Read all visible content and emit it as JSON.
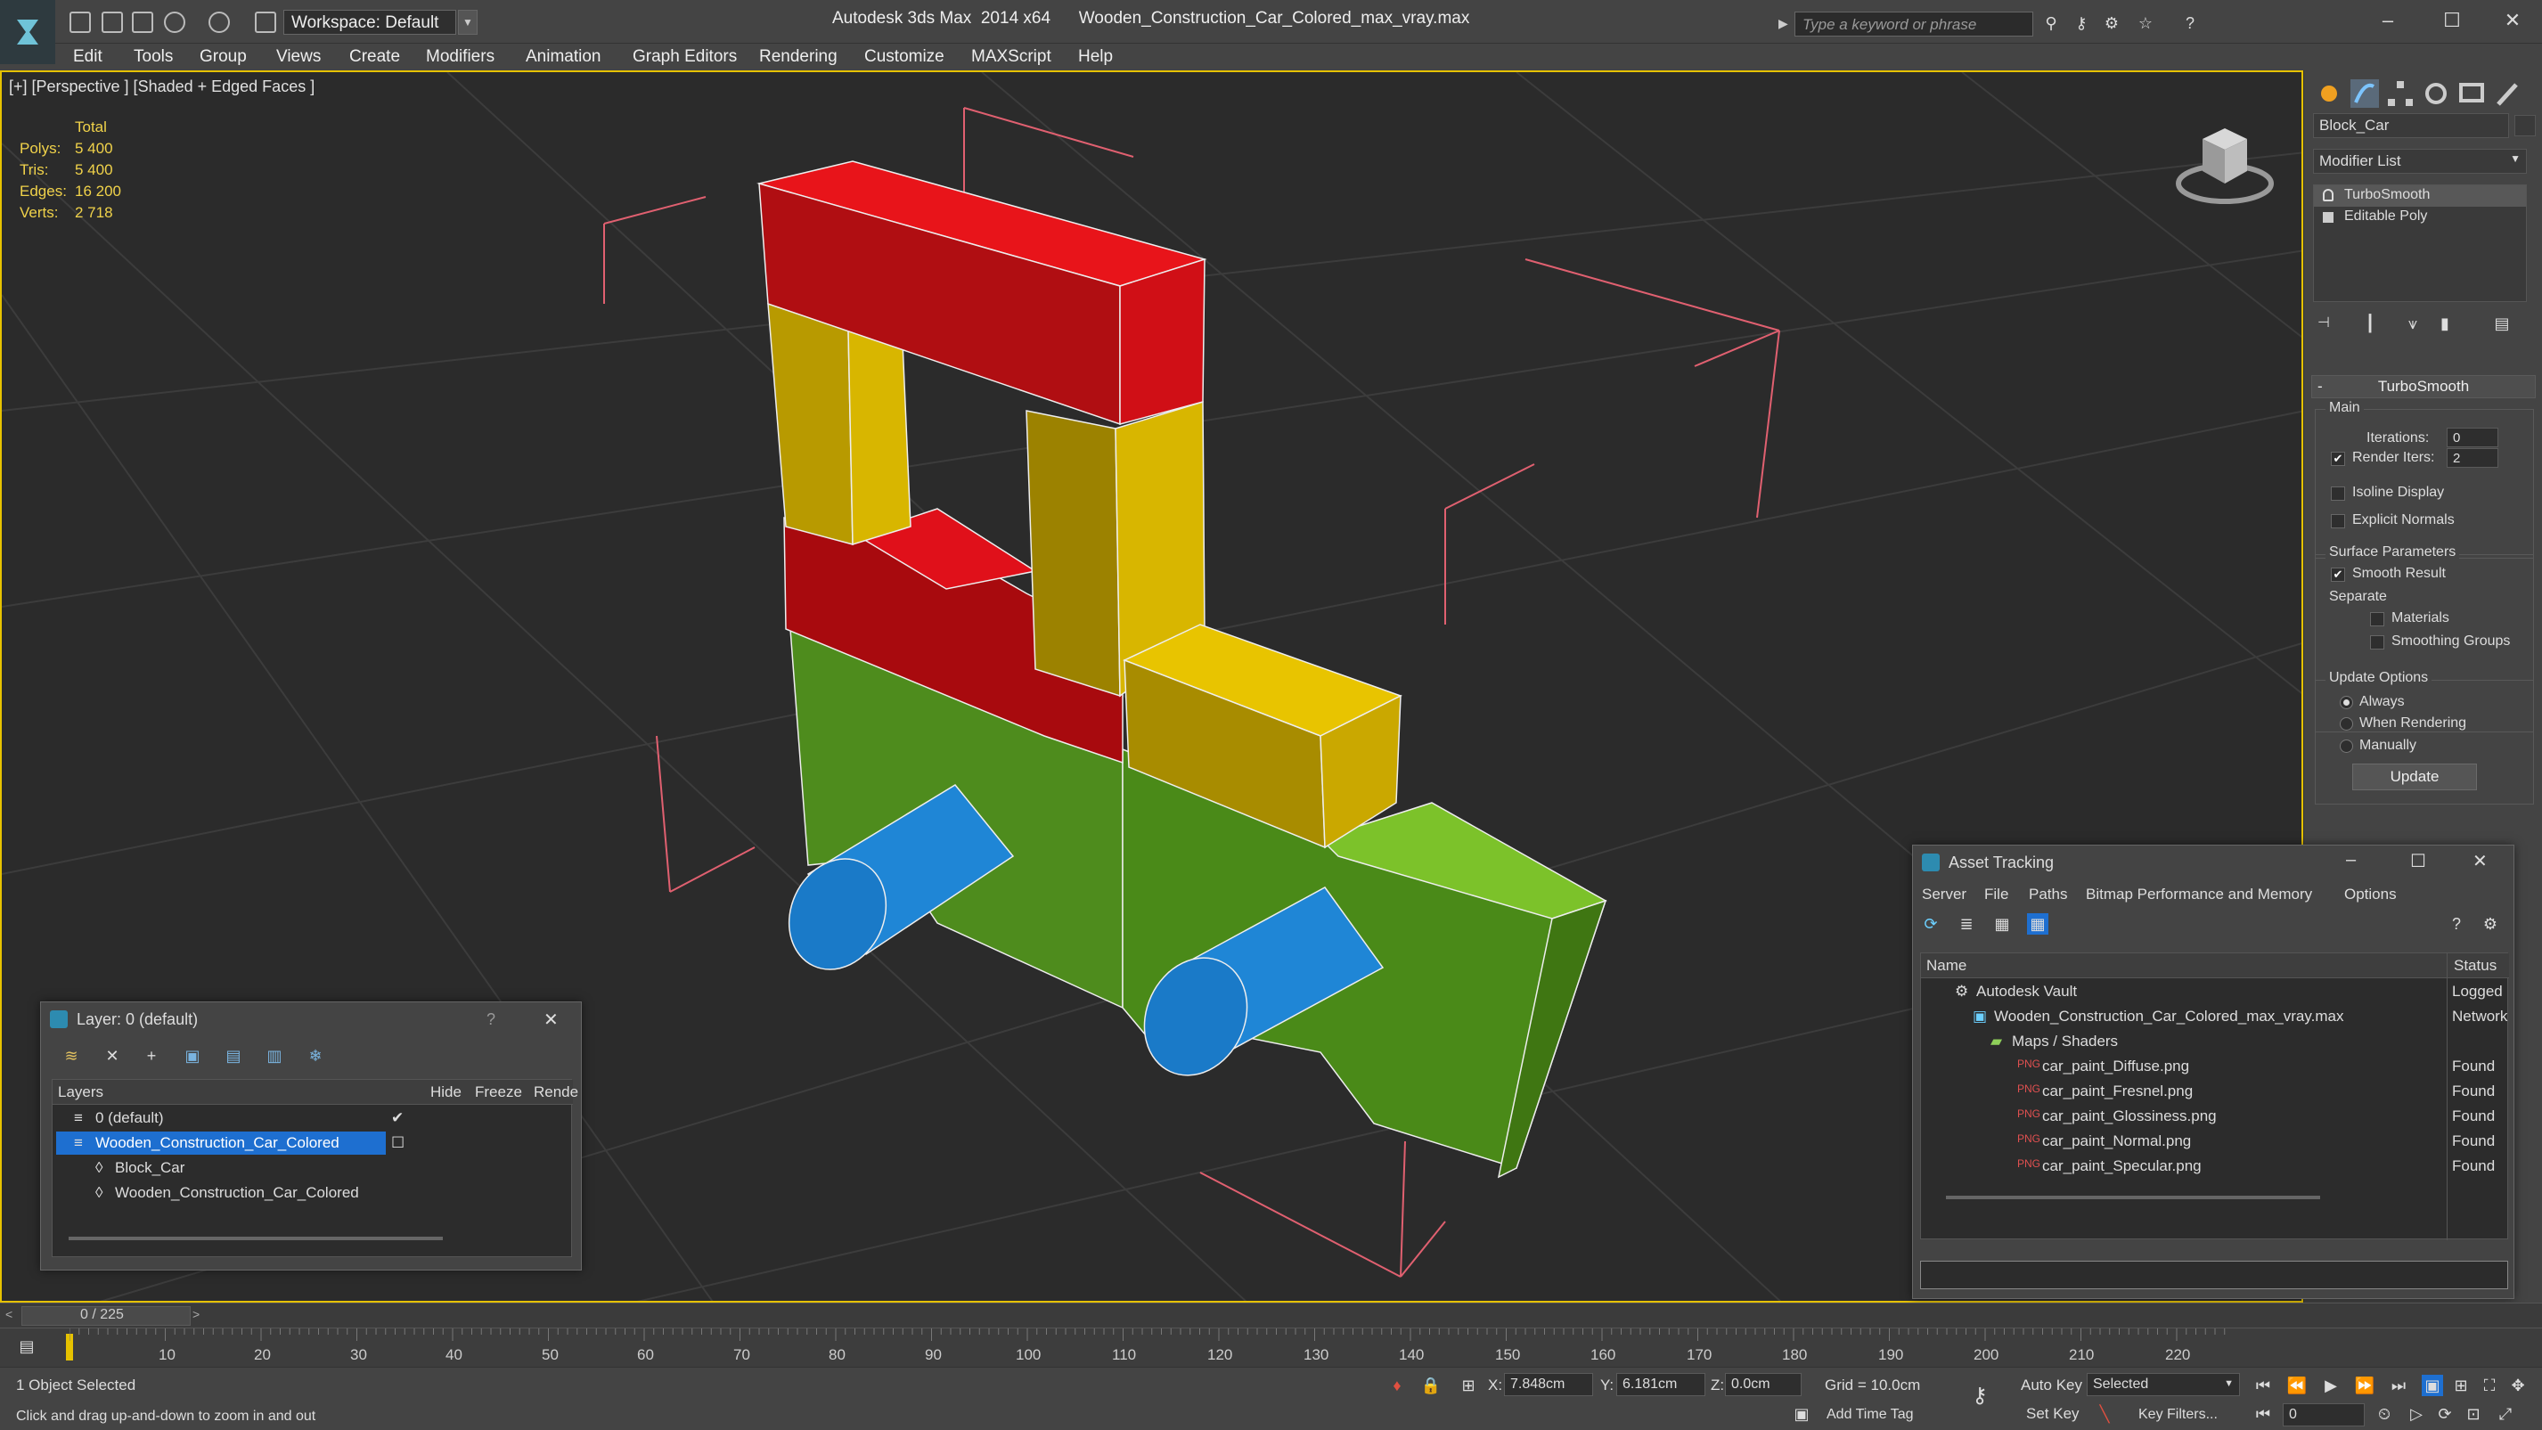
{
  "app": {
    "title": "Autodesk 3ds Max  2014 x64      Wooden_Construction_Car_Colored_max_vray.max",
    "workspace": "Workspace: Default",
    "search_placeholder": "Type a keyword or phrase"
  },
  "menu": [
    "Edit",
    "Tools",
    "Group",
    "Views",
    "Create",
    "Modifiers",
    "Animation",
    "Graph Editors",
    "Rendering",
    "Customize",
    "MAXScript",
    "Help"
  ],
  "viewport": {
    "label": "[+] [Perspective ] [Shaded + Edged Faces ]",
    "stats": {
      "header": "Total",
      "rows": [
        {
          "label": "Polys:",
          "value": "5 400"
        },
        {
          "label": "Tris:",
          "value": "5 400"
        },
        {
          "label": "Edges:",
          "value": "16 200"
        },
        {
          "label": "Verts:",
          "value": "2 718"
        }
      ]
    }
  },
  "command_panel": {
    "object_name": "Block_Car",
    "modifier_list": "Modifier List",
    "stack": [
      "TurboSmooth",
      "Editable Poly"
    ],
    "rollout": {
      "title": "TurboSmooth",
      "main": "Main",
      "iterations_label": "Iterations:",
      "iterations_value": "0",
      "render_iters_label": "Render Iters:",
      "render_iters_value": "2",
      "isoline": "Isoline Display",
      "explicit_normals": "Explicit Normals",
      "surface_params": "Surface Parameters",
      "smooth_result": "Smooth Result",
      "separate": "Separate",
      "materials": "Materials",
      "smoothing_groups": "Smoothing Groups",
      "update_options": "Update Options",
      "always": "Always",
      "when_rendering": "When Rendering",
      "manually": "Manually",
      "update_button": "Update"
    }
  },
  "layer_dialog": {
    "title": "Layer: 0 (default)",
    "help": "?",
    "columns": [
      "Layers",
      "Hide",
      "Freeze",
      "Rende"
    ],
    "rows": [
      "0 (default)",
      "Wooden_Construction_Car_Colored",
      "Block_Car",
      "Wooden_Construction_Car_Colored"
    ]
  },
  "asset_tracking": {
    "title": "Asset Tracking",
    "menu": [
      "Server",
      "File",
      "Paths",
      "Bitmap Performance and Memory",
      "Options"
    ],
    "columns": [
      "Name",
      "Status"
    ],
    "rows": [
      {
        "name": "Autodesk Vault",
        "status": "Logged"
      },
      {
        "name": "Wooden_Construction_Car_Colored_max_vray.max",
        "status": "Network"
      },
      {
        "name": "Maps / Shaders",
        "status": ""
      },
      {
        "name": "car_paint_Diffuse.png",
        "status": "Found"
      },
      {
        "name": "car_paint_Fresnel.png",
        "status": "Found"
      },
      {
        "name": "car_paint_Glossiness.png",
        "status": "Found"
      },
      {
        "name": "car_paint_Normal.png",
        "status": "Found"
      },
      {
        "name": "car_paint_Specular.png",
        "status": "Found"
      }
    ]
  },
  "timeline": {
    "frame": "0 / 225",
    "ticks": [
      "10",
      "20",
      "30",
      "40",
      "50",
      "60",
      "70",
      "80",
      "90",
      "100",
      "110",
      "120",
      "130",
      "140",
      "150",
      "160",
      "170",
      "180",
      "190",
      "200",
      "210",
      "220"
    ]
  },
  "status": {
    "selected": "1 Object Selected",
    "prompt": "Click and drag up-and-down to zoom in and out",
    "x": "7.848cm",
    "y": "6.181cm",
    "z": "0.0cm",
    "grid": "Grid = 10.0cm",
    "auto_key": "Auto Key",
    "set_key": "Set Key",
    "selected_dropdown": "Selected",
    "key_filters": "Key Filters...",
    "add_time_tag": "Add Time Tag",
    "frame_field": "0"
  },
  "colors": {
    "accent": "#e6c200",
    "viewport_bg": "#2b2b2b",
    "selection": "#1e6fd0",
    "stats": "#f0d24a"
  }
}
